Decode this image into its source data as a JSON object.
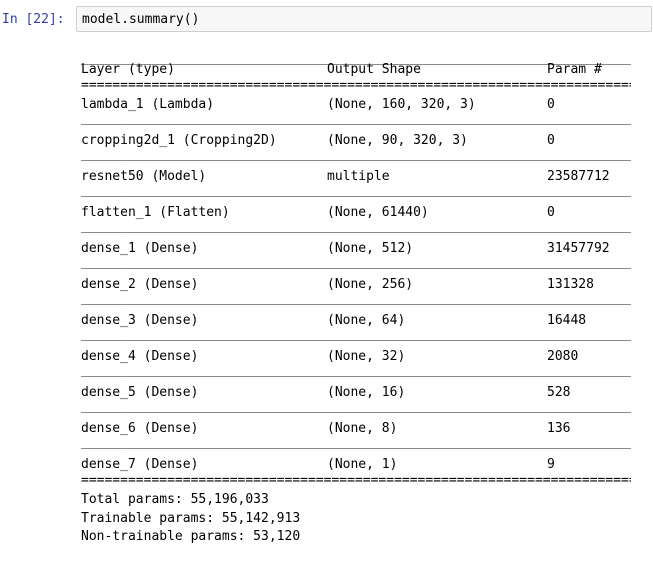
{
  "input_prompt": "In [22]:",
  "input_code": "model.summary()",
  "rules": {
    "top": "__________________________________________________________________________________",
    "double": "==================================================================================",
    "single": "__________________________________________________________________________________"
  },
  "header": {
    "layer": "Layer (type)",
    "output_shape": "Output Shape",
    "param": "Param #"
  },
  "rows": [
    {
      "layer": "lambda_1 (Lambda)",
      "output_shape": "(None, 160, 320, 3)",
      "param": "0"
    },
    {
      "layer": "cropping2d_1 (Cropping2D)",
      "output_shape": "(None, 90, 320, 3)",
      "param": "0"
    },
    {
      "layer": "resnet50 (Model)",
      "output_shape": "multiple",
      "param": "23587712"
    },
    {
      "layer": "flatten_1 (Flatten)",
      "output_shape": "(None, 61440)",
      "param": "0"
    },
    {
      "layer": "dense_1 (Dense)",
      "output_shape": "(None, 512)",
      "param": "31457792"
    },
    {
      "layer": "dense_2 (Dense)",
      "output_shape": "(None, 256)",
      "param": "131328"
    },
    {
      "layer": "dense_3 (Dense)",
      "output_shape": "(None, 64)",
      "param": "16448"
    },
    {
      "layer": "dense_4 (Dense)",
      "output_shape": "(None, 32)",
      "param": "2080"
    },
    {
      "layer": "dense_5 (Dense)",
      "output_shape": "(None, 16)",
      "param": "528"
    },
    {
      "layer": "dense_6 (Dense)",
      "output_shape": "(None, 8)",
      "param": "136"
    },
    {
      "layer": "dense_7 (Dense)",
      "output_shape": "(None, 1)",
      "param": "9"
    }
  ],
  "totals": {
    "total": "Total params: 55,196,033",
    "trainable": "Trainable params: 55,142,913",
    "non_trainable": "Non-trainable params: 53,120"
  }
}
